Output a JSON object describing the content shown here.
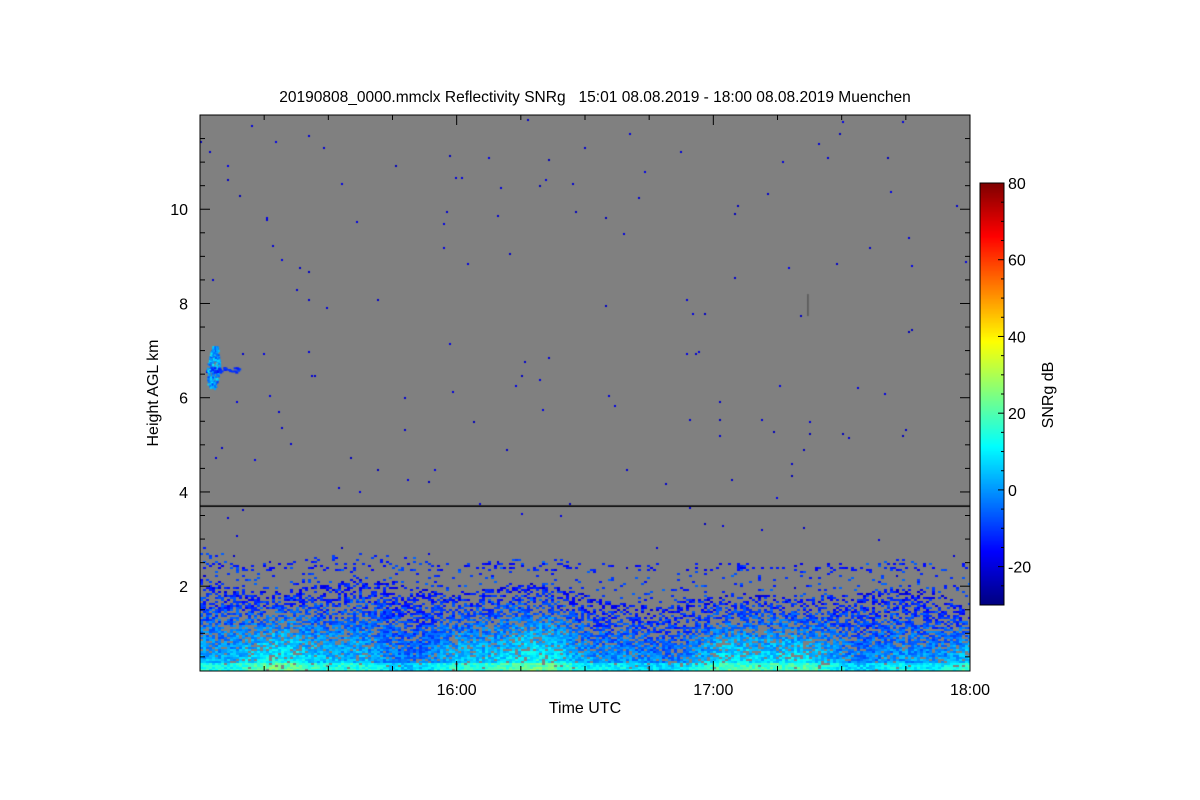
{
  "chart_data": {
    "type": "heatmap",
    "title": "20190808_0000.mmclx Reflectivity SNRg   15:01 08.08.2019 - 18:00 08.08.2019 Muenchen",
    "xlabel": "Time UTC",
    "ylabel": "Height AGL km",
    "xlim": [
      "15:00",
      "18:00"
    ],
    "ylim": [
      0.2,
      12
    ],
    "x_ticks": [
      "16:00",
      "17:00",
      "18:00"
    ],
    "y_ticks": [
      "2",
      "4",
      "6",
      "8",
      "10"
    ],
    "background_color": "#808080",
    "reference_line_height_km": 3.7,
    "colorbar": {
      "label": "SNRg dB",
      "range": [
        -30,
        80
      ],
      "ticks": [
        "80",
        "60",
        "40",
        "20",
        "0",
        "-20"
      ],
      "colormap": "jet"
    },
    "boundary_layer_echo_top_km": {
      "time": [
        "15:00",
        "15:15",
        "15:30",
        "15:45",
        "16:00",
        "16:15",
        "16:30",
        "16:45",
        "17:00",
        "17:15",
        "17:30",
        "17:45",
        "18:00"
      ],
      "height": [
        2.2,
        2.0,
        1.9,
        2.1,
        2.0,
        1.9,
        1.8,
        1.7,
        1.6,
        1.8,
        1.9,
        1.8,
        1.6
      ]
    },
    "cloud_patch": {
      "time": "15:03",
      "height_range_km": [
        6.2,
        7.1
      ],
      "snr_db": [
        -15,
        10
      ]
    }
  }
}
